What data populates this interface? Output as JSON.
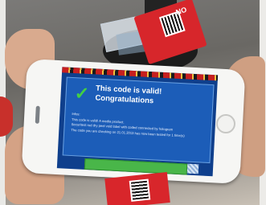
{
  "screen": {
    "title": "This code is valid!",
    "subtitle": "Congratulations",
    "lines": [
      "Infos:",
      "This code is valid! A media product.",
      "Securitest red dry peel void label with coded connected by hologram",
      "The code you are checking on 21.01.2013 has now been tested for 1 time(s)"
    ]
  },
  "tags": {
    "top_code": "NO"
  }
}
